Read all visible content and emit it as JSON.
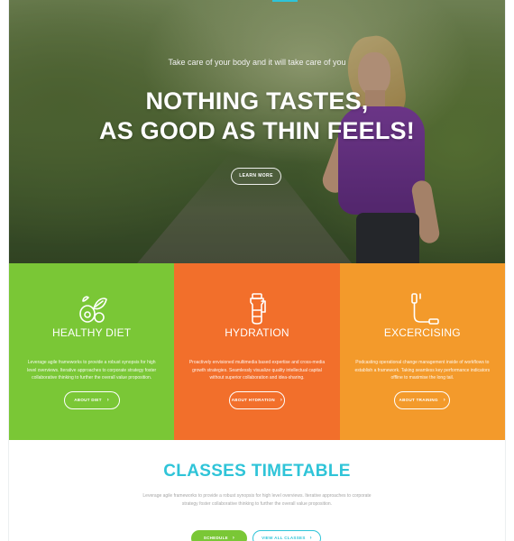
{
  "hero": {
    "tagline": "Take care of your body and it will take care of you",
    "headline_line1": "NOTHING TASTES,",
    "headline_line2": "AS GOOD AS THIN FEELS!",
    "button_label": "LEARN MORE"
  },
  "features": [
    {
      "title": "HEALTHY DIET",
      "icon": "healthy-diet-icon",
      "color": "#7ac736",
      "description": "Leverage agile frameworks to provide a robust synopsis for high level overviews. Iterative approaches to corporate strategy foster collaborative thinking to further the overall value proposition.",
      "button_label": "ABOUT DIET"
    },
    {
      "title": "HYDRATION",
      "icon": "water-bottle-icon",
      "color": "#f26f2b",
      "description": "Proactively envisioned multimedia based expertise and cross-media growth strategies. Seamlessly visualize quality intellectual capital without superior collaboration and idea-sharing.",
      "button_label": "ABOUT HYDRATION"
    },
    {
      "title": "EXCERCISING",
      "icon": "jump-rope-icon",
      "color": "#f39a2b",
      "description": "Podcasting operational change management inside of workflows to establish a framework. Taking seamless key performance indicators offline to maximise the long tail.",
      "button_label": "ABOUT TRAINING"
    }
  ],
  "timetable": {
    "title": "CLASSES TIMETABLE",
    "description": "Leverage agile frameworks to provide a robust synopsis for high level overviews. Iterative approaches to corporate strategy foster collaborative thinking to further the overall value proposition.",
    "primary_button": "SCHEDULE",
    "secondary_button": "VIEW ALL CLASSES"
  },
  "colors": {
    "accent": "#2fc4d8",
    "green": "#7ac736",
    "orange": "#f26f2b",
    "amber": "#f39a2b"
  }
}
